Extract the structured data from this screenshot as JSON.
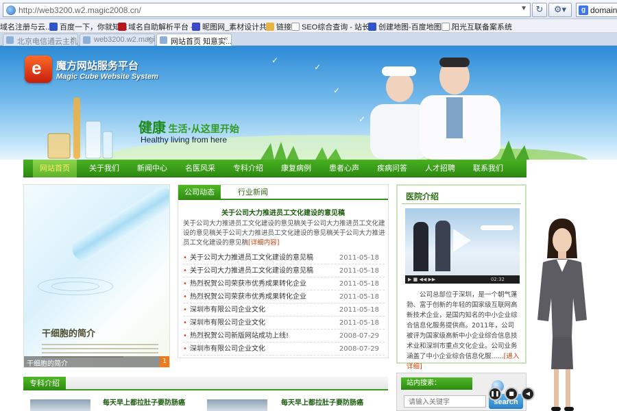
{
  "browser": {
    "url": "http://web3200.w2.magic2008.cn/",
    "search_engine": "domain:",
    "bookmarks": [
      "域名注册与云...",
      "百度一下，你就知道",
      "域名自助解析平台 -...",
      "昵图网_素材设计共...",
      "链接",
      "SEO综合查询 - 站长...",
      "创建地图-百度地图A...",
      "阳光互联备案系统"
    ],
    "tabs": [
      {
        "title": "北京电信通云主机-...",
        "active": false
      },
      {
        "title": "web3200.w2.magi...",
        "active": false
      },
      {
        "title": "网站首页  知意实...",
        "active": true
      }
    ]
  },
  "header": {
    "logo_cn": "魔方网站服务平台",
    "logo_en": "Magic Cube Website System",
    "slogan_big": "健康",
    "slogan_rest": "生活·从这里开始",
    "slogan_en": "Healthy living from here"
  },
  "nav": [
    "网站首页",
    "关于我们",
    "新闻中心",
    "名医风采",
    "专科介绍",
    "康复病例",
    "患者心声",
    "疾病问答",
    "人才招聘",
    "联系我们"
  ],
  "feature": {
    "title": "干细胞的简介",
    "caption": "干细胞的简介",
    "index": "1"
  },
  "news": {
    "tabs": [
      "公司动态",
      "行业新闻"
    ],
    "headline": "关于公司大力推进员工文化建设的意见稿",
    "summary": "关于公司大力推进员工文化建设的意见稿关于公司大力推进员工文化建设的意见稿关于公司大力推进员工文化建设的意见稿关于公司大力推进员工文化建设的意见稿",
    "more": "[详细内容]",
    "items": [
      {
        "title": "关于公司大力推进员工文化建设的意见稿",
        "date": "2011-05-18"
      },
      {
        "title": "关于公司大力推进员工文化建设的意见稿",
        "date": "2011-05-18"
      },
      {
        "title": "热烈祝贺公司荣获市优秀成果转化企业",
        "date": "2011-05-18"
      },
      {
        "title": "热烈祝贺公司荣获市优秀成果转化企业",
        "date": "2011-05-18"
      },
      {
        "title": "深圳市有限公司企业文化",
        "date": "2011-05-18"
      },
      {
        "title": "深圳市有限公司企业文化",
        "date": "2011-05-18"
      },
      {
        "title": "热烈祝贺公司新版网站成功上线!",
        "date": "2008-07-29"
      },
      {
        "title": "深圳市有限公司企业文化",
        "date": "2008-07-29"
      }
    ]
  },
  "intro": {
    "title": "医院介绍",
    "video_time": "02:32",
    "text": "公司总部位于深圳，是一个朝气蓬勃、富于创新的年轻的国家级互联网高新技术企业，是国内知名的中小企业综合信息化服务提供商。2011年，公司被评为国家级高新中小企业综合信息技术业和深圳市重点文化企业。公司业务涵盖了中小企业综合信息化服......",
    "more": "[进入详细]"
  },
  "specialty": {
    "title": "专科介绍",
    "items": [
      "每天早上都拉肚子要防肠癌",
      "每天早上都拉肚子要防肠癌"
    ]
  },
  "site_search": {
    "title": "站内搜索：",
    "placeholder": "请输入关键字",
    "button": "search"
  }
}
